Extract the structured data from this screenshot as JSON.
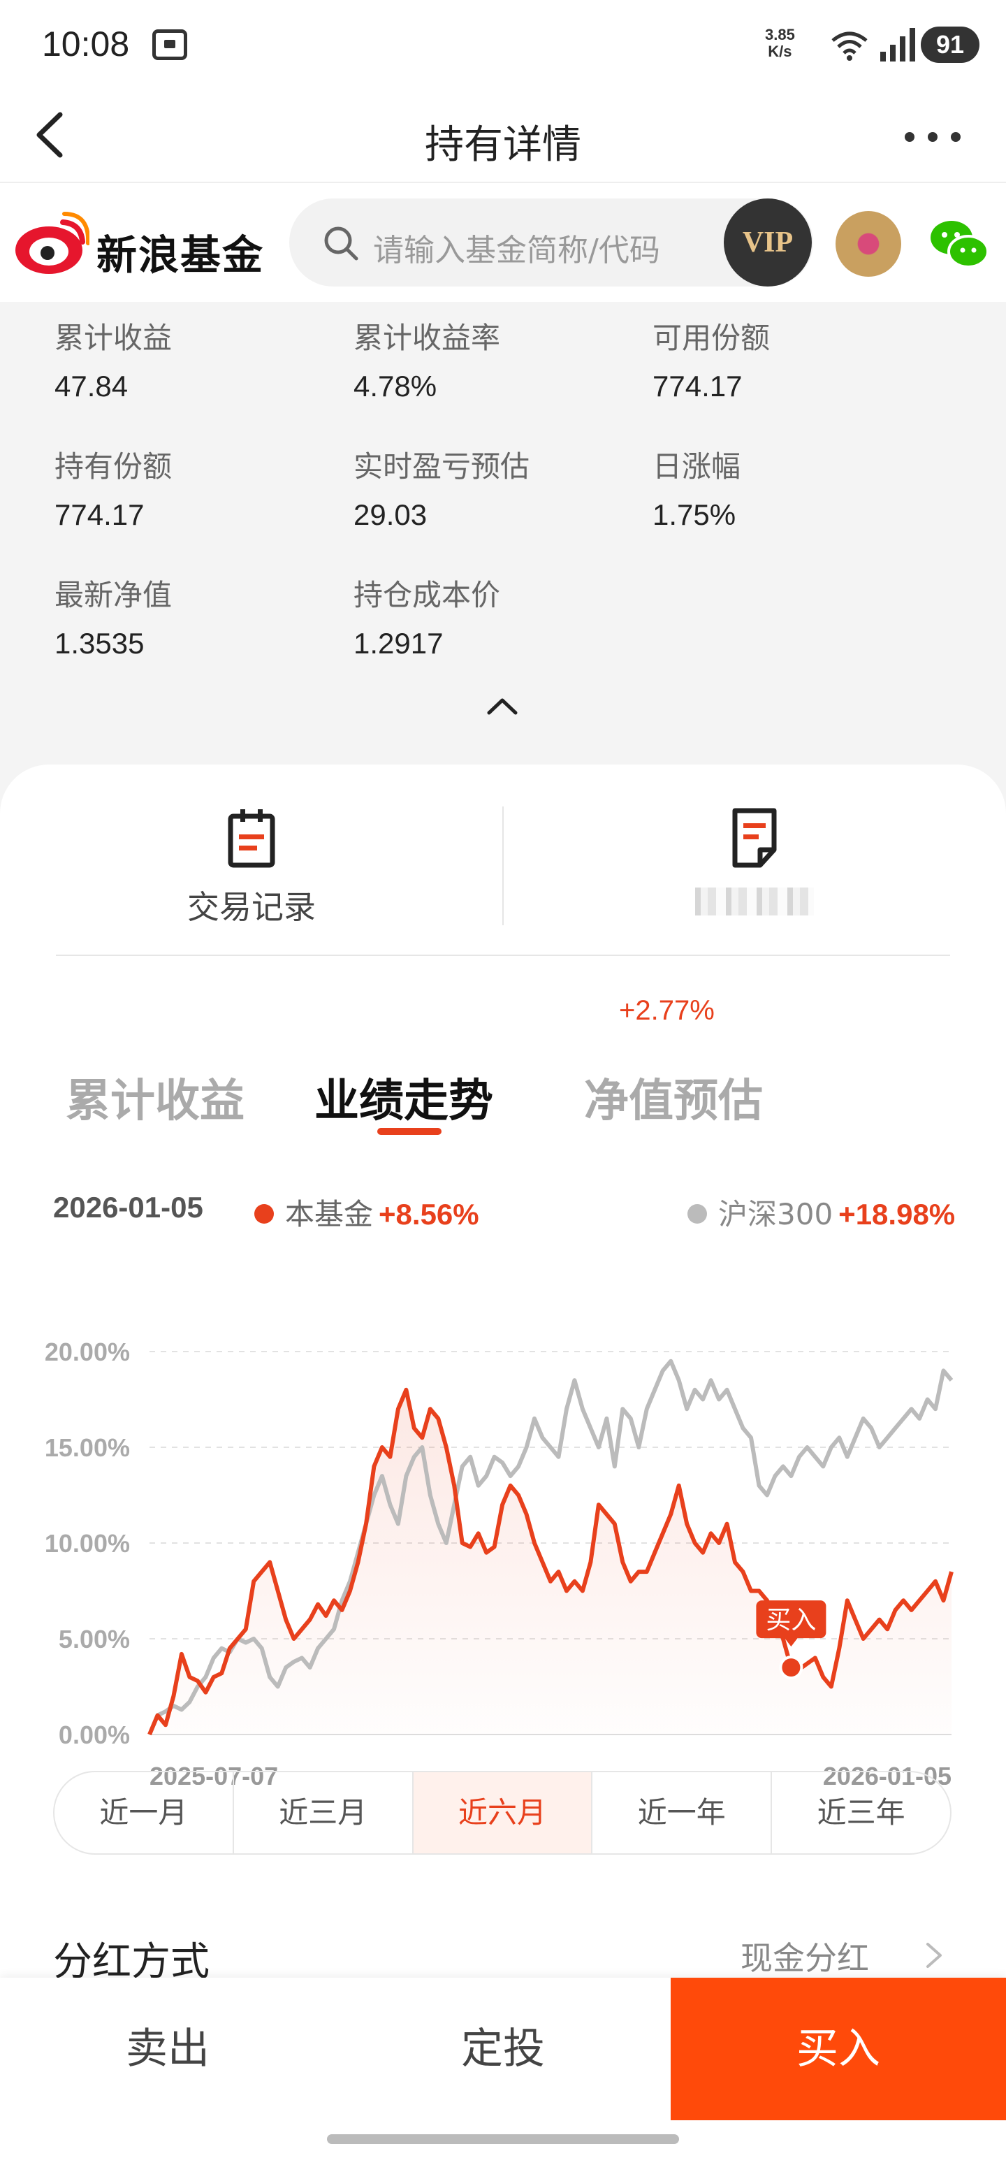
{
  "status_bar": {
    "time": "10:08",
    "net_speed_value": "3.85",
    "net_speed_unit": "K/s",
    "battery": "91"
  },
  "nav": {
    "title": "持有详情",
    "back_icon": "chevron-left-icon",
    "more_icon": "more-icon"
  },
  "search": {
    "logo_text": "新浪基金",
    "placeholder": "请输入基金简称/代码",
    "vip_label": "VIP"
  },
  "holding": {
    "items": [
      {
        "label": "累计收益",
        "value": "47.84"
      },
      {
        "label": "累计收益率",
        "value": "4.78%"
      },
      {
        "label": "可用份额",
        "value": "774.17"
      },
      {
        "label": "持有份额",
        "value": "774.17"
      },
      {
        "label": "实时盈亏预估",
        "value": "29.03"
      },
      {
        "label": "日涨幅",
        "value": "1.75%"
      },
      {
        "label": "最新净值",
        "value": "1.3535"
      },
      {
        "label": "持仓成本价",
        "value": "1.2917"
      }
    ]
  },
  "actions": {
    "trade_record_label": "交易记录"
  },
  "tabs": {
    "items": [
      "累计收益",
      "业绩走势",
      "净值预估"
    ],
    "active_index": 1,
    "estimate_badge": "+2.77%"
  },
  "legend": {
    "date": "2026-01-05",
    "fund_name": "本基金",
    "fund_change": "+8.56%",
    "bench_name": "沪深300",
    "bench_change": "+18.98%"
  },
  "ranges": {
    "items": [
      "近一月",
      "近三月",
      "近六月",
      "近一年",
      "近三年"
    ],
    "active_index": 2
  },
  "dividend": {
    "label": "分红方式",
    "value": "现金分红"
  },
  "bottom": {
    "sell": "卖出",
    "sip": "定投",
    "buy": "买入"
  },
  "colors": {
    "accent": "#e8401c",
    "buy_button": "#ff4a0a",
    "benchmark": "#bbbbbb"
  },
  "chart_data": {
    "type": "line",
    "x_start_label": "2025-07-07",
    "x_end_label": "2026-01-05",
    "y_ticks": [
      "20.00%",
      "15.00%",
      "10.00%",
      "5.00%",
      "0.00%"
    ],
    "ylim": [
      0,
      20
    ],
    "buy_marker_label": "买入",
    "buy_marker_index": 80,
    "series": [
      {
        "name": "本基金",
        "color": "#e8401c",
        "values": [
          0,
          1,
          0.5,
          2,
          4.2,
          3,
          2.8,
          2.2,
          3,
          3.2,
          4.5,
          5,
          5.5,
          8,
          8.5,
          9,
          7.5,
          6,
          5,
          5.5,
          6,
          6.8,
          6.2,
          7,
          6.5,
          7.5,
          9,
          11,
          14,
          15,
          14.5,
          17,
          18,
          16,
          15.5,
          17,
          16.5,
          15,
          13,
          10,
          9.8,
          10.5,
          9.5,
          9.8,
          12,
          13,
          12.5,
          11.5,
          10,
          9,
          8,
          8.5,
          7.5,
          8,
          7.5,
          9,
          12,
          11.5,
          11,
          9,
          8,
          8.5,
          8.5,
          9.5,
          10.5,
          11.5,
          13,
          11,
          10,
          9.5,
          10.5,
          10,
          11,
          9,
          8.5,
          7.5,
          7.5,
          7,
          6,
          5,
          3.5,
          3.4,
          3.7,
          4,
          3,
          2.5,
          4.5,
          7,
          6,
          5,
          5.5,
          6,
          5.5,
          6.5,
          7,
          6.5,
          7,
          7.5,
          8,
          7,
          8.5
        ]
      },
      {
        "name": "沪深300",
        "color": "#bbbbbb",
        "values": [
          0,
          1,
          1.2,
          1.5,
          1.3,
          1.7,
          2.5,
          3,
          4,
          4.5,
          4.3,
          5,
          4.8,
          5,
          4.5,
          3,
          2.5,
          3.5,
          3.8,
          4,
          3.5,
          4.5,
          5,
          5.5,
          7,
          8,
          9.5,
          11,
          12.5,
          13.5,
          12,
          11,
          13.5,
          14.5,
          15,
          12.5,
          11,
          10,
          12,
          14,
          14.5,
          13,
          13.5,
          14.5,
          14.2,
          13.5,
          14,
          15,
          16.5,
          15.5,
          15,
          14.5,
          17,
          18.5,
          17,
          16,
          15,
          16.5,
          14,
          17,
          16.5,
          15,
          17,
          18,
          19,
          19.5,
          18.5,
          17,
          18,
          17.5,
          18.5,
          17.5,
          18,
          17,
          16,
          15.5,
          13,
          12.5,
          13.5,
          14,
          13.5,
          14.5,
          15,
          14.5,
          14,
          15,
          15.5,
          14.5,
          15.5,
          16.5,
          16,
          15,
          15.5,
          16,
          16.5,
          17,
          16.5,
          17.5,
          17,
          19,
          18.5
        ]
      }
    ]
  }
}
